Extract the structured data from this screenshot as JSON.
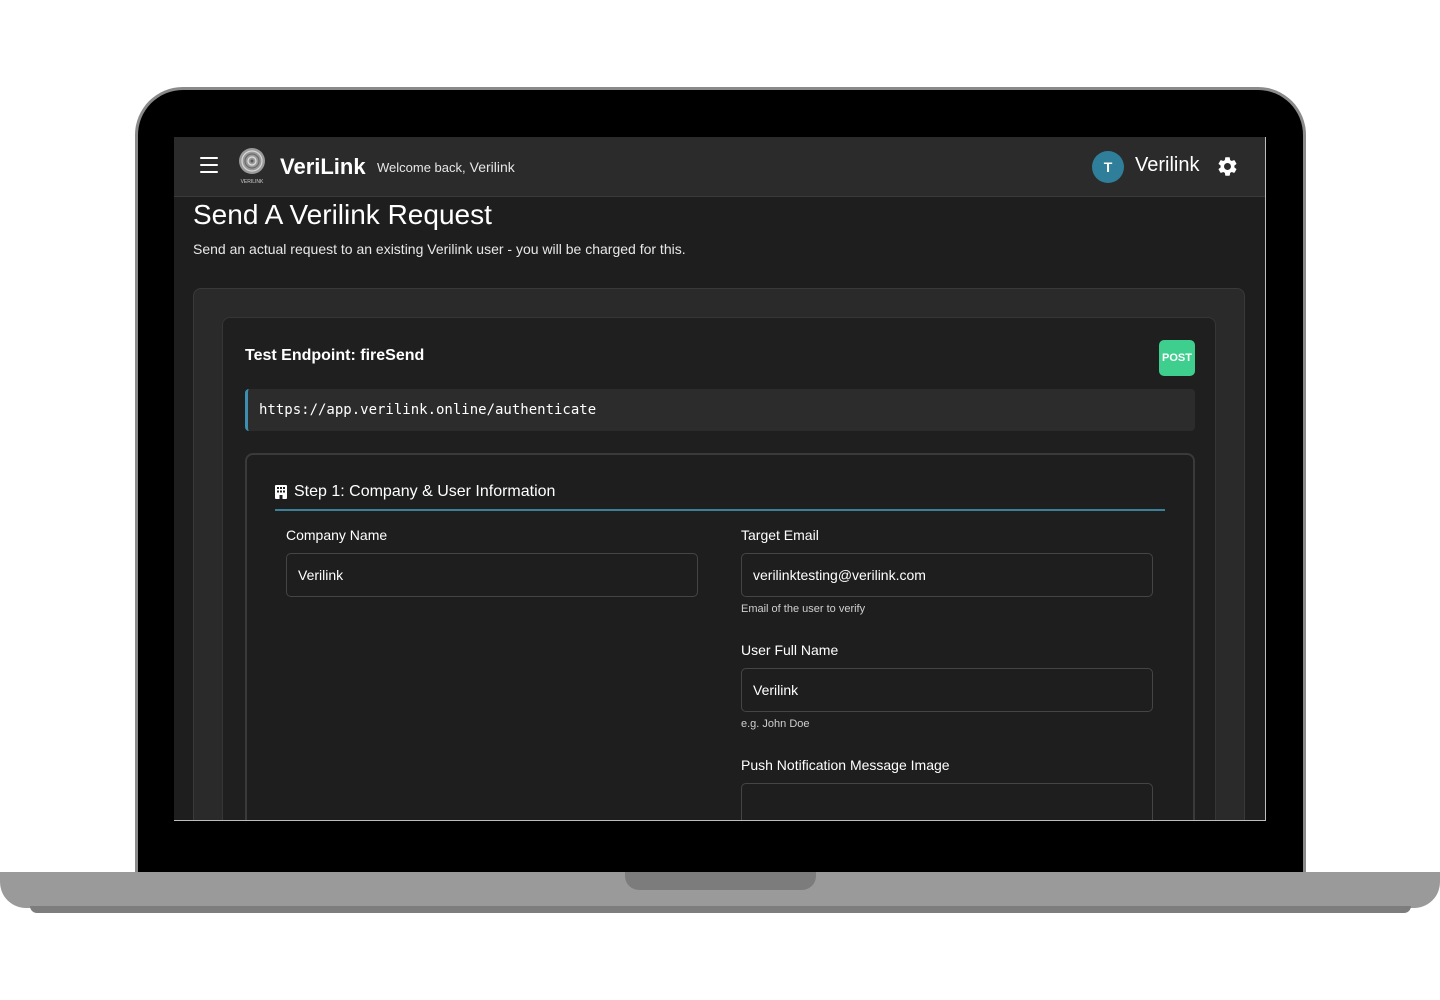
{
  "navbar": {
    "logo_caption": "VERILINK",
    "brand": "VeriLink",
    "welcome_prefix": "Welcome back,",
    "welcome_name": "Verilink",
    "avatar_initial": "T",
    "user_name": "Verilink"
  },
  "page": {
    "title": "Send A Verilink Request",
    "subtitle": "Send an actual request to an existing Verilink user - you will be charged for this."
  },
  "endpoint": {
    "title": "Test Endpoint: fireSend",
    "method": "POST",
    "url": "https://app.verilink.online/authenticate"
  },
  "step1": {
    "title": "Step 1: Company & User Information",
    "company_name_label": "Company Name",
    "company_name_value": "Verilink",
    "target_email_label": "Target Email",
    "target_email_value": "verilinktesting@verilink.com",
    "target_email_help": "Email of the user to verify",
    "user_full_name_label": "User Full Name",
    "user_full_name_value": "Verilink",
    "user_full_name_help": "e.g. John Doe",
    "push_image_label": "Push Notification Message Image",
    "push_image_value": ""
  },
  "colors": {
    "accent": "#3d8eb0",
    "post_badge": "#3ecf8e",
    "avatar": "#2f7f9a"
  }
}
